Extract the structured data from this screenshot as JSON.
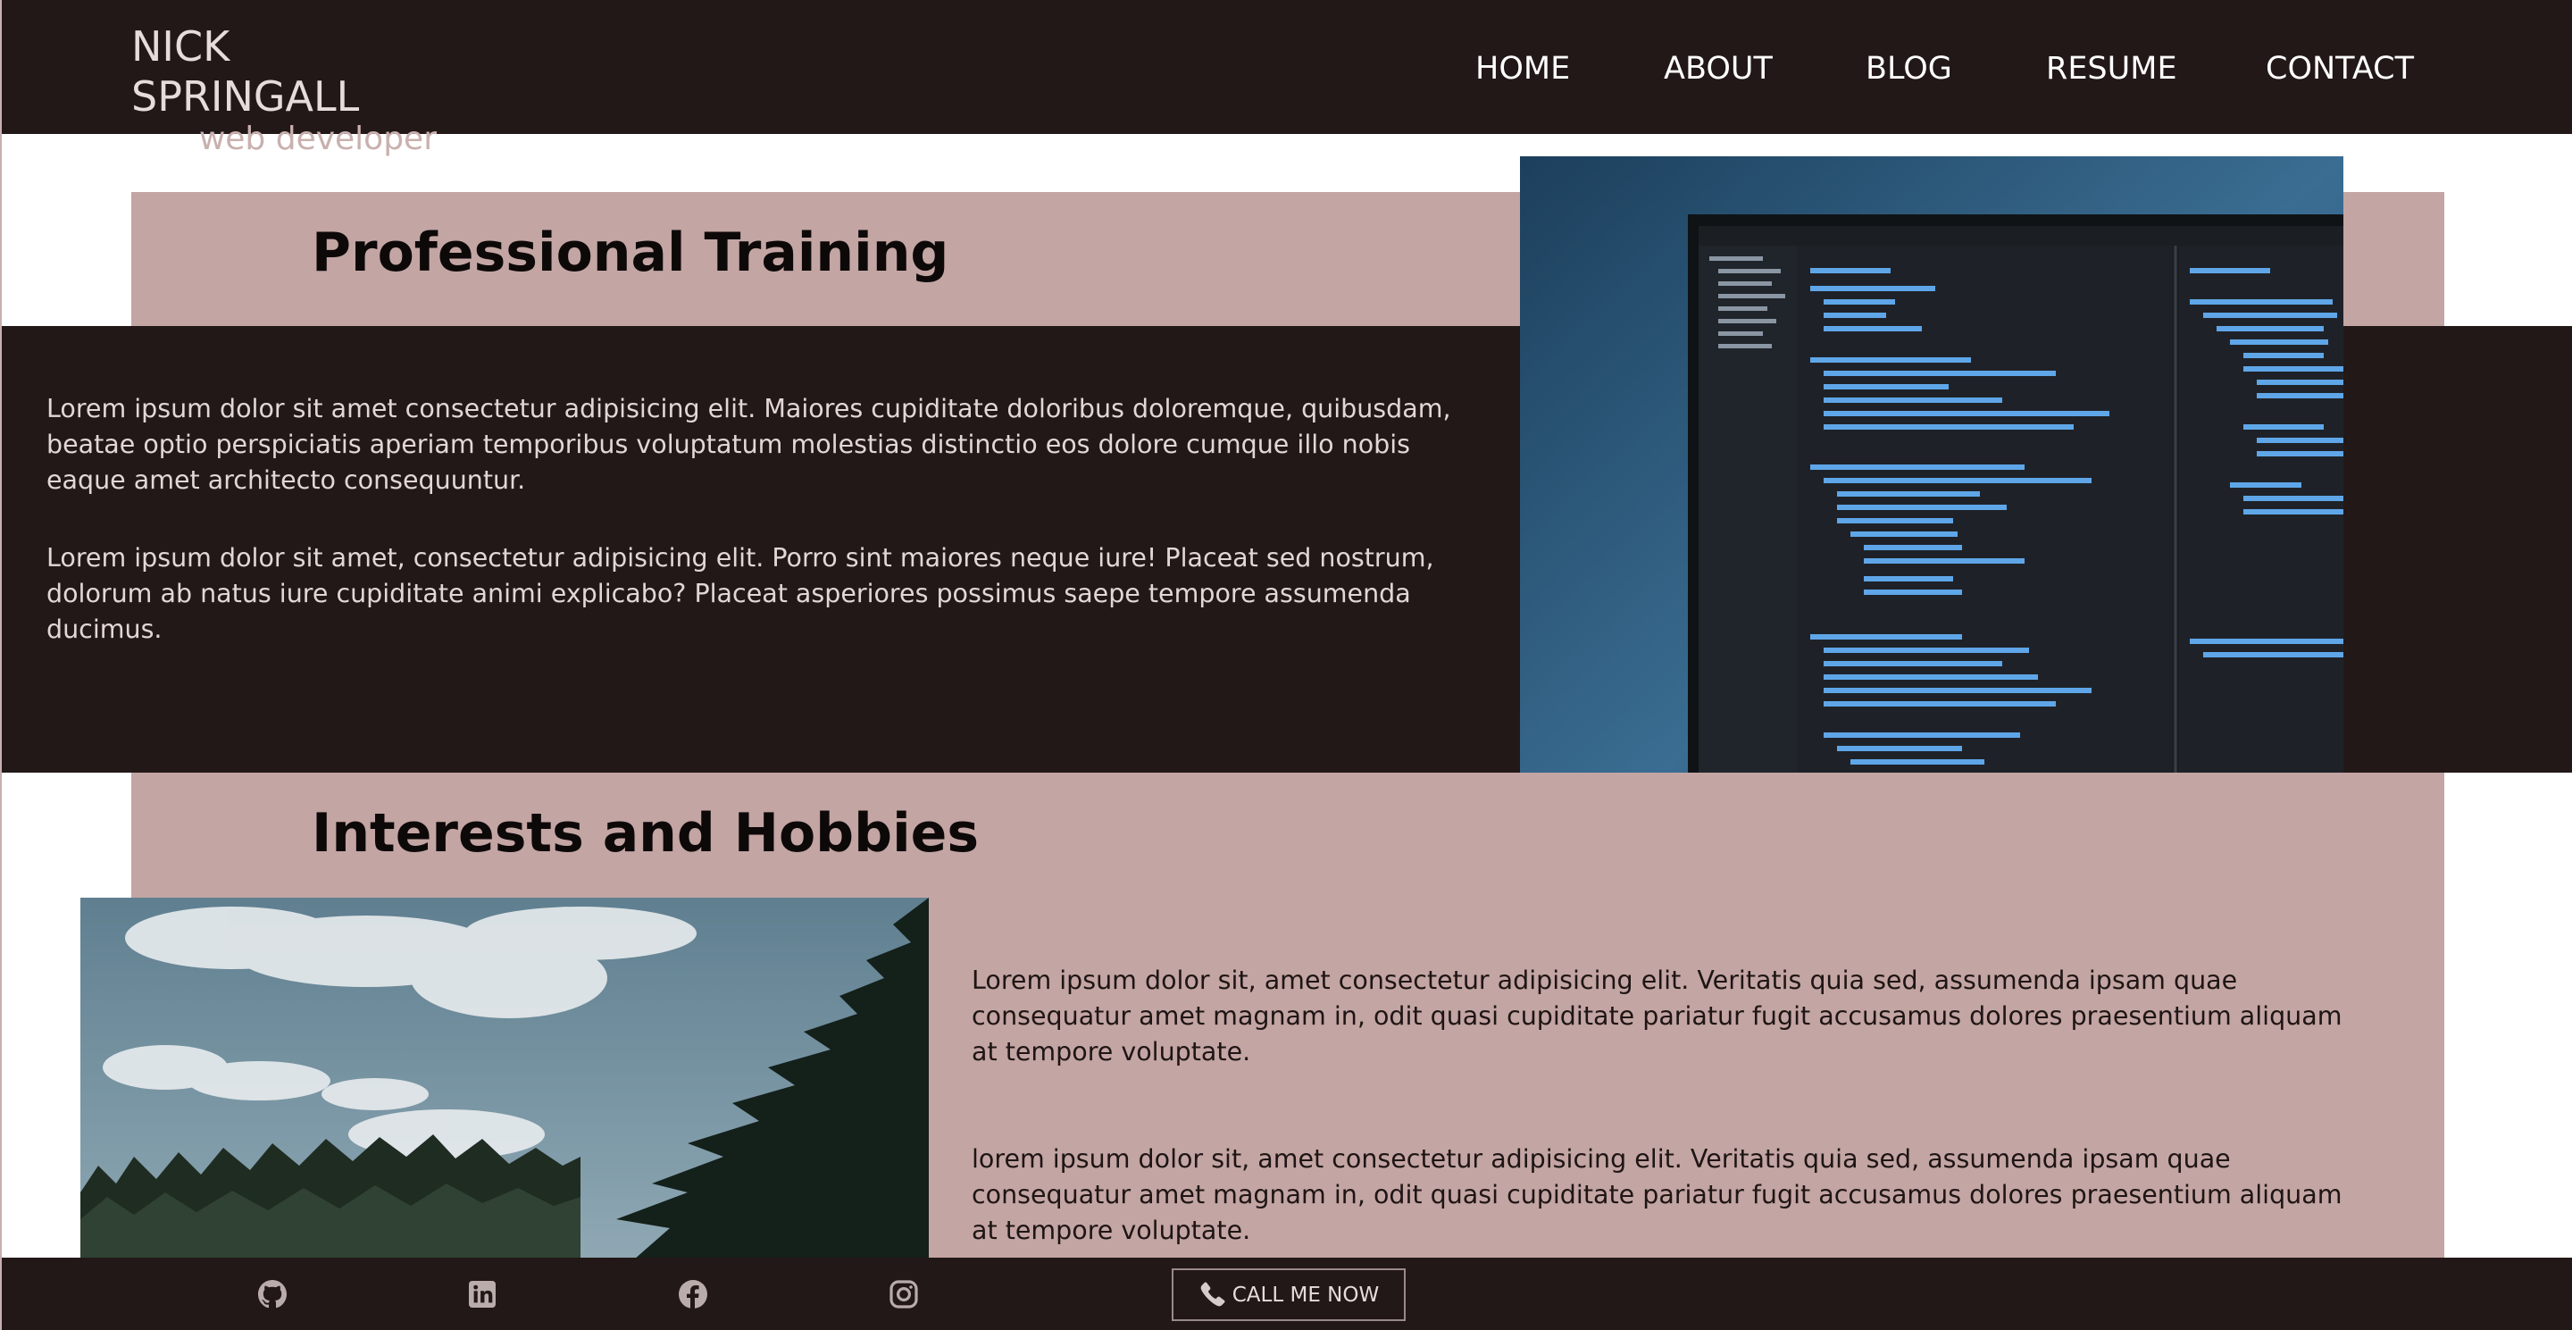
{
  "header": {
    "brand_name": "NICK SPRINGALL",
    "brand_tagline": "web developer",
    "nav": [
      "HOME",
      "ABOUT",
      "BLOG",
      "RESUME",
      "CONTACT"
    ]
  },
  "training": {
    "title": "Professional Training",
    "paragraphs": [
      "Lorem ipsum dolor sit amet consectetur adipisicing elit. Maiores cupiditate doloribus doloremque, quibusdam, beatae optio perspiciatis aperiam temporibus voluptatum molestias distinctio eos dolore cumque illo nobis eaque amet architecto consequuntur.",
      "Lorem ipsum dolor sit amet, consectetur adipisicing elit. Porro sint maiores neque iure! Placeat sed nostrum, dolorum ab natus iure cupiditate animi explicabo? Placeat asperiores possimus saepe tempore assumenda ducimus."
    ]
  },
  "hobbies": {
    "title": "Interests and Hobbies",
    "paragraphs": [
      "Lorem ipsum dolor sit, amet consectetur adipisicing elit. Veritatis quia sed, assumenda ipsam quae consequatur amet magnam in, odit quasi cupiditate pariatur fugit accusamus dolores praesentium aliquam at tempore voluptate.",
      "lorem ipsum dolor sit, amet consectetur adipisicing elit. Veritatis quia sed, assumenda ipsam quae consequatur amet magnam in, odit quasi cupiditate pariatur fugit accusamus dolores praesentium aliquam at tempore voluptate."
    ]
  },
  "footer": {
    "socials": [
      "github-icon",
      "linkedin-icon",
      "facebook-icon",
      "instagram-icon"
    ],
    "call_label": "CALL ME NOW"
  },
  "colors": {
    "dark": "#221817",
    "pink": "#c3a5a3",
    "light_text": "#e3d6d6"
  }
}
